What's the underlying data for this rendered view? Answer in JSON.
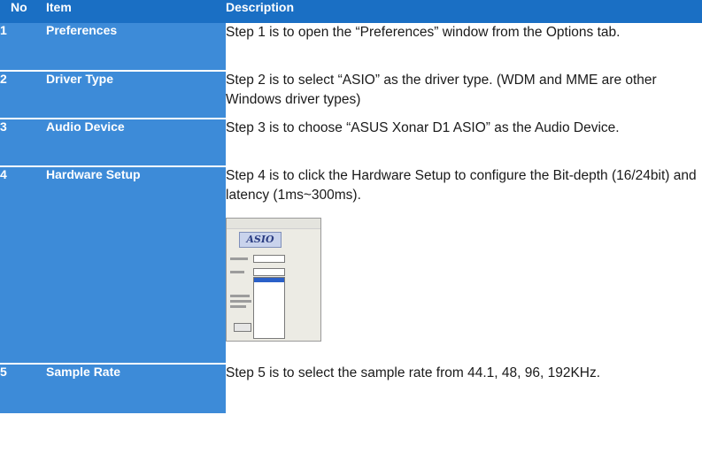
{
  "headers": {
    "no": "No",
    "item": "Item",
    "description": "Description"
  },
  "rows": [
    {
      "no": "1",
      "item": "Preferences",
      "description": "Step 1 is to open the “Preferences” window from the Options tab."
    },
    {
      "no": "2",
      "item": "Driver Type",
      "description": "Step 2 is to select “ASIO” as the driver type. (WDM and MME are other Windows driver types)"
    },
    {
      "no": "3",
      "item": "Audio Device",
      "description": "Step 3 is to choose “ASUS Xonar D1 ASIO” as the Audio Device."
    },
    {
      "no": "4",
      "item": "Hardware Setup",
      "description": "Step 4 is to click the Hardware Setup to configure the Bit-depth (16/24bit) and latency (1ms~300ms)."
    },
    {
      "no": "5",
      "item": "Sample Rate",
      "description": "Step 5 is to select the sample rate from 44.1, 48, 96, 192KHz."
    }
  ],
  "asio_panel": {
    "logo": "ASIO"
  },
  "colors": {
    "header_bg": "#1a6fc4",
    "row_label_bg": "#3d8bd8",
    "text": "#1a1a1a"
  }
}
